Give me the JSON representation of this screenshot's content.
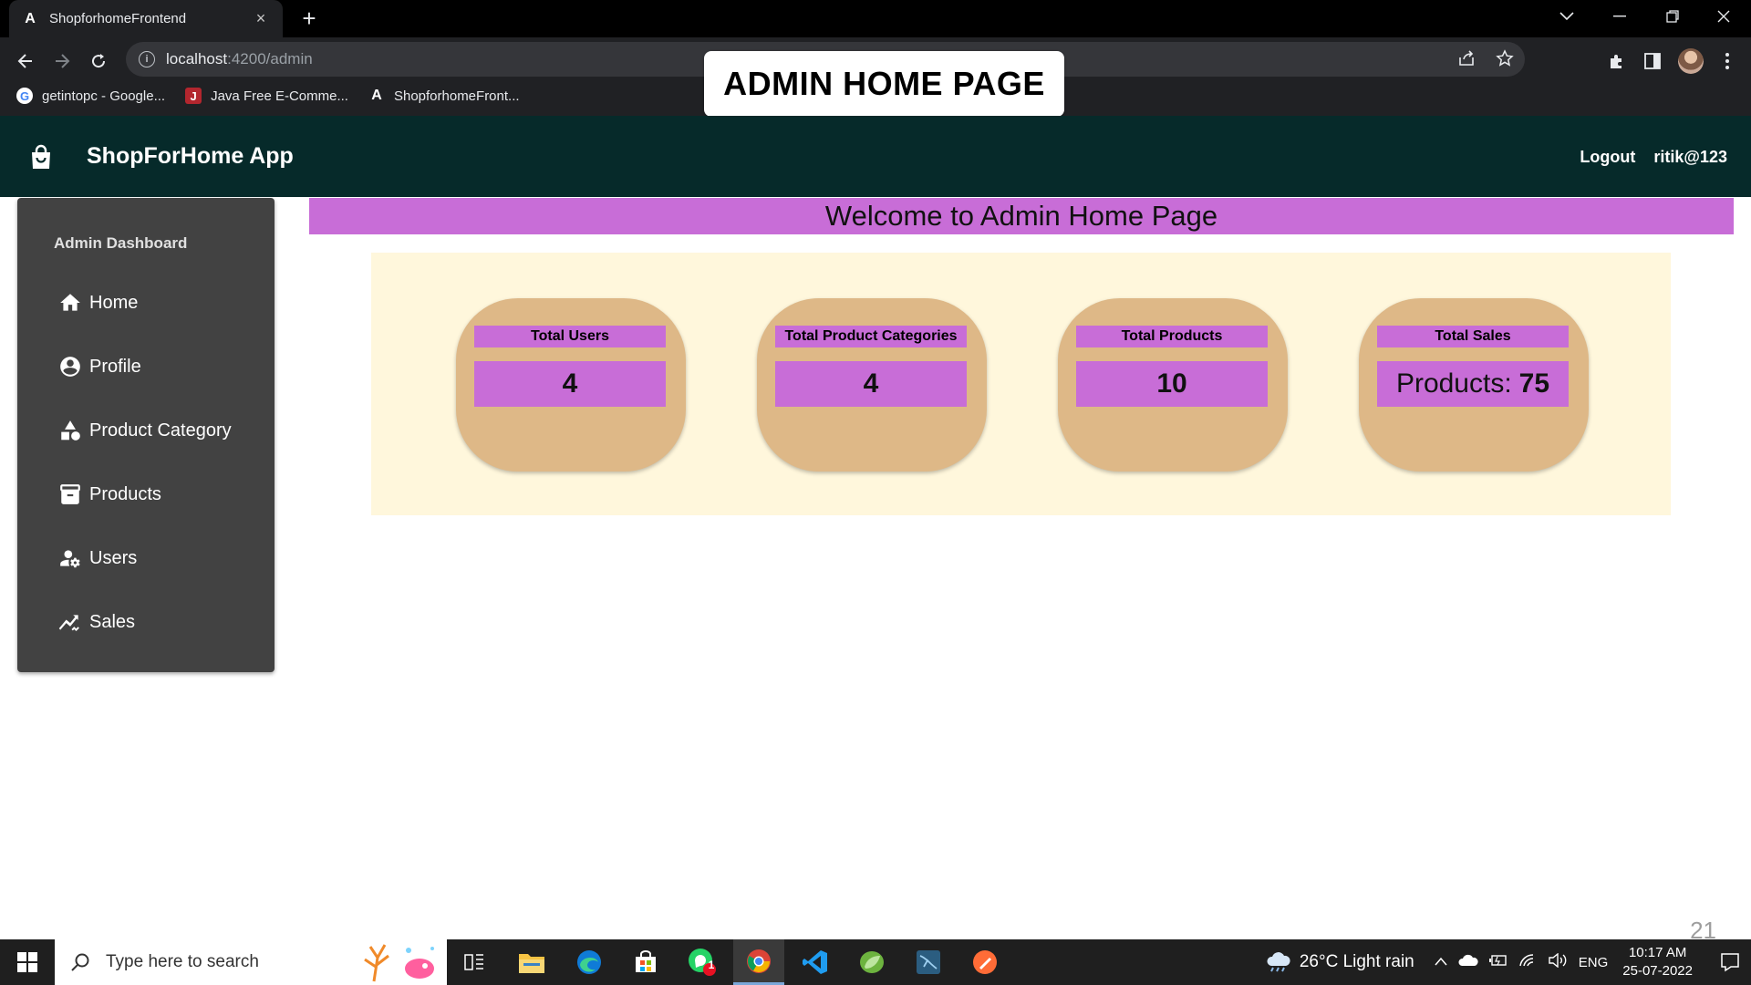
{
  "browser": {
    "tab_title": "ShopforhomeFrontend",
    "tab_close": "×",
    "new_tab": "+",
    "url_host": "localhost",
    "url_path": ":4200/admin",
    "bookmarks": [
      {
        "label": "getintopc - Google..."
      },
      {
        "label": "Java Free E-Comme..."
      },
      {
        "label": "ShopforhomeFront..."
      }
    ]
  },
  "overlay": {
    "label": "ADMIN HOME PAGE"
  },
  "app": {
    "title": "ShopForHome App",
    "logout": "Logout",
    "username": "ritik@123"
  },
  "sidebar": {
    "header": "Admin Dashboard",
    "items": [
      {
        "label": "Home",
        "icon": "home-icon"
      },
      {
        "label": "Profile",
        "icon": "account-circle-icon"
      },
      {
        "label": "Product Category",
        "icon": "category-icon"
      },
      {
        "label": "Products",
        "icon": "inventory-icon"
      },
      {
        "label": "Users",
        "icon": "manage-accounts-icon"
      },
      {
        "label": "Sales",
        "icon": "trending-icon"
      }
    ]
  },
  "main": {
    "welcome": "Welcome to Admin Home Page",
    "stats": [
      {
        "label": "Total Users",
        "prefix": "",
        "value": "4"
      },
      {
        "label": "Total Product Categories",
        "prefix": "",
        "value": "4"
      },
      {
        "label": "Total Products",
        "prefix": "",
        "value": "10"
      },
      {
        "label": "Total Sales",
        "prefix": "Products:",
        "value": "75"
      }
    ]
  },
  "page_number": "21",
  "taskbar": {
    "search_placeholder": "Type here to search",
    "weather": "26°C  Light rain",
    "lang": "ENG",
    "time": "10:17 AM",
    "date": "25-07-2022",
    "whatsapp_badge": "1"
  },
  "colors": {
    "appbar": "#062a2a",
    "sidebar": "#424242",
    "accent_purple": "#c86dd7",
    "card": "#deb887",
    "panel": "#fff7dc"
  }
}
